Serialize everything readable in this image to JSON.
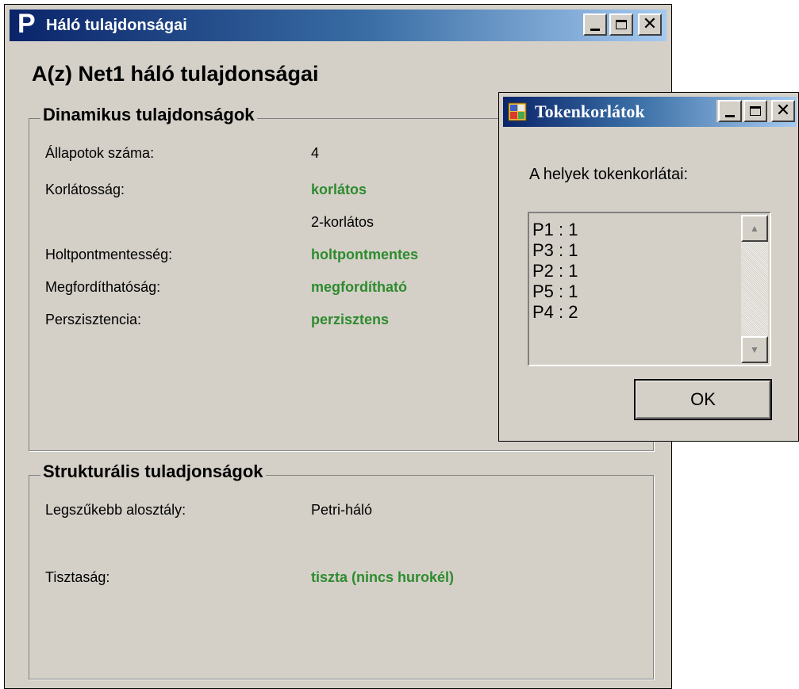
{
  "main_window": {
    "title": "Háló tulajdonságai",
    "app_icon_letter": "P",
    "heading": "A(z) Net1 háló tulajdonságai"
  },
  "dynamic_group": {
    "title": "Dinamikus tulajdonságok",
    "rows": [
      {
        "label": "Állapotok száma:",
        "value": "4"
      },
      {
        "label": "Korlátosság:",
        "value": "korlátos"
      },
      {
        "label": "",
        "value": "2-korlátos"
      },
      {
        "label": "Holtpontmentesség:",
        "value": "holtpontmentes"
      },
      {
        "label": "Megfordíthatóság:",
        "value": "megfordítható"
      },
      {
        "label": "Perszisztencia:",
        "value": "perzisztens"
      }
    ]
  },
  "structural_group": {
    "title": "Strukturális tuladjonságok",
    "rows": [
      {
        "label": "Legszűkebb alosztály:",
        "value": "Petri-háló"
      },
      {
        "label": "Tisztaság:",
        "value": "tiszta (nincs hurokél)"
      }
    ]
  },
  "dialog": {
    "title": "Tokenkorlátok",
    "prompt": "A helyek tokenkorlátai:",
    "items": [
      "P1 : 1",
      "P3 : 1",
      "P2 : 1",
      "P5 : 1",
      "P4 : 2"
    ],
    "ok_label": "OK"
  },
  "colors": {
    "positive_value": "#2e8b2e",
    "title_start": "#0a246a",
    "title_end": "#a6caf0",
    "face": "#d4d0c8"
  },
  "icons": {
    "minimize": "minimize-icon",
    "maximize": "maximize-icon",
    "close": "close-icon"
  }
}
